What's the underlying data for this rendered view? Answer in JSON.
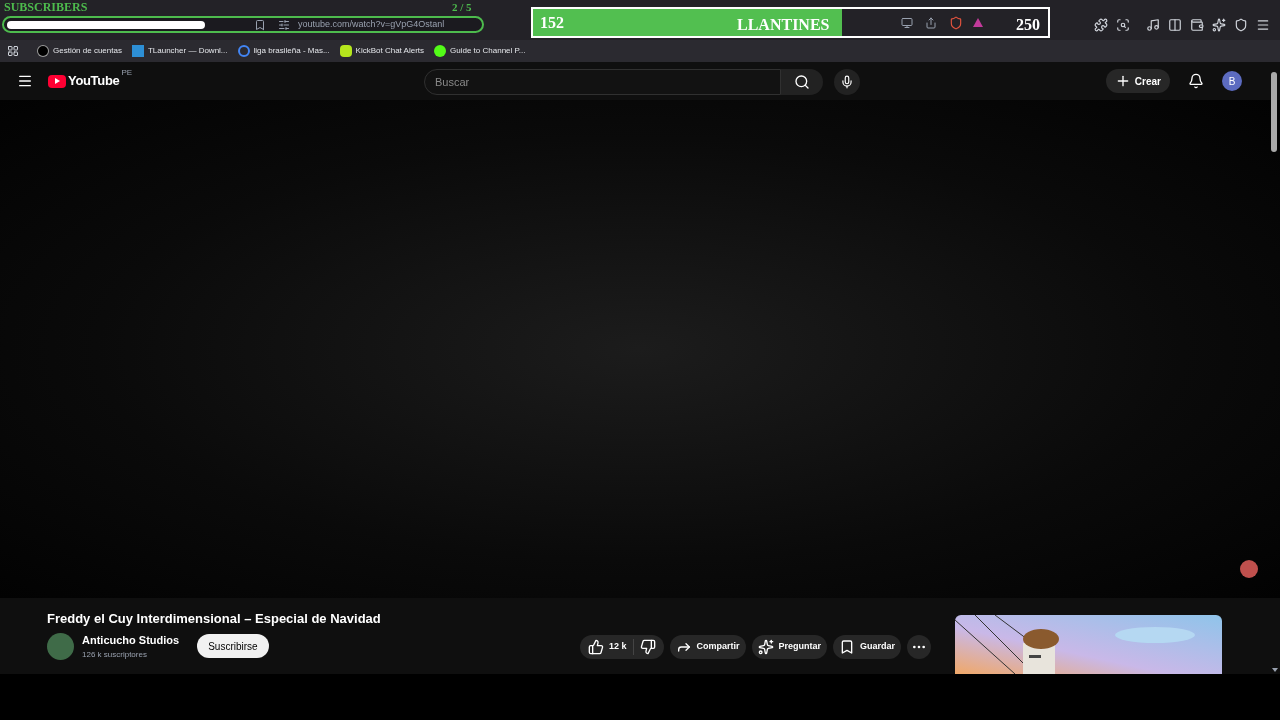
{
  "overlay": {
    "label": "SUBSCRIBERS",
    "count": "2 / 5",
    "level": 0.42
  },
  "goal": {
    "current": "152",
    "name": "LLANTINES",
    "target": "250",
    "level": 0.6
  },
  "address_bar": {
    "url": "youtube.com/watch?v=gVpG4Ostanl"
  },
  "bookmarks": [
    {
      "kind": "ea",
      "label": "Gestión de cuentas"
    },
    {
      "kind": "tl",
      "label": "TLauncher — Downl..."
    },
    {
      "kind": "google",
      "label": "liga brasileña - Mas..."
    },
    {
      "kind": "kick",
      "label": "KickBot Chat Alerts"
    },
    {
      "kind": "guide",
      "label": "Guide to Channel P..."
    }
  ],
  "youtube": {
    "logo": "YouTube",
    "region": "PE",
    "search": {
      "placeholder": "Buscar"
    },
    "create": "Crear",
    "avatar": "B"
  },
  "video": {
    "title": "Freddy el Cuy Interdimensional – Especial de Navidad",
    "channel": "Anticucho Studios",
    "subscribers": "126 k suscriptores",
    "subscribe": "Suscribirse",
    "likes": "12 k",
    "actions": [
      {
        "kind": "share",
        "label": "Compartir"
      },
      {
        "kind": "ask",
        "label": "Preguntar"
      },
      {
        "kind": "save",
        "label": "Guardar"
      }
    ]
  }
}
